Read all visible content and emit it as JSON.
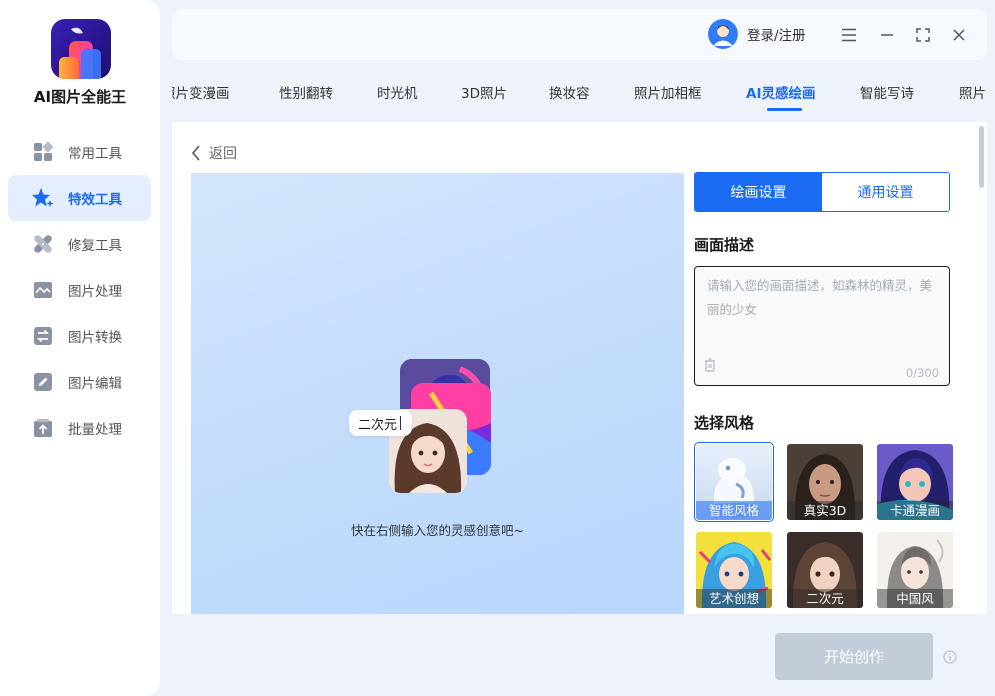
{
  "app": {
    "name": "AI图片全能王"
  },
  "sidebar": {
    "items": [
      {
        "label": "常用工具",
        "icon": "grid-icon",
        "active": false
      },
      {
        "label": "特效工具",
        "icon": "star-icon",
        "active": true
      },
      {
        "label": "修复工具",
        "icon": "bandage-icon",
        "active": false
      },
      {
        "label": "图片处理",
        "icon": "image-icon",
        "active": false
      },
      {
        "label": "图片转换",
        "icon": "convert-icon",
        "active": false
      },
      {
        "label": "图片编辑",
        "icon": "edit-icon",
        "active": false
      },
      {
        "label": "批量处理",
        "icon": "upload-icon",
        "active": false
      }
    ]
  },
  "topbar": {
    "user_label": "登录/注册"
  },
  "tabs": [
    {
      "label": "照片变漫画"
    },
    {
      "label": "性别翻转"
    },
    {
      "label": "时光机"
    },
    {
      "label": "3D照片"
    },
    {
      "label": "换妆容"
    },
    {
      "label": "照片加相框"
    },
    {
      "label": "AI灵感绘画",
      "active": true
    },
    {
      "label": "智能写诗"
    },
    {
      "label": "照片"
    }
  ],
  "main": {
    "back_label": "返回",
    "preview": {
      "tag": "二次元",
      "hint": "快在右侧输入您的灵感创意吧~"
    },
    "settings": {
      "tabs": [
        {
          "label": "绘画设置",
          "active": true
        },
        {
          "label": "通用设置",
          "active": false
        }
      ],
      "desc_title": "画面描述",
      "desc_placeholder": "请输入您的画面描述，如森林的精灵，美丽的少女",
      "desc_value": "",
      "counter": "0/300",
      "style_title": "选择风格",
      "styles": [
        {
          "label": "智能风格",
          "selected": true
        },
        {
          "label": "真实3D",
          "selected": false
        },
        {
          "label": "卡通漫画",
          "selected": false
        },
        {
          "label": "艺术创想",
          "selected": false
        },
        {
          "label": "二次元",
          "selected": false
        },
        {
          "label": "中国风",
          "selected": false
        }
      ]
    }
  },
  "footer": {
    "start_label": "开始创作"
  },
  "colors": {
    "accent": "#1b6cf2",
    "disabled": "#c3ccd9"
  }
}
